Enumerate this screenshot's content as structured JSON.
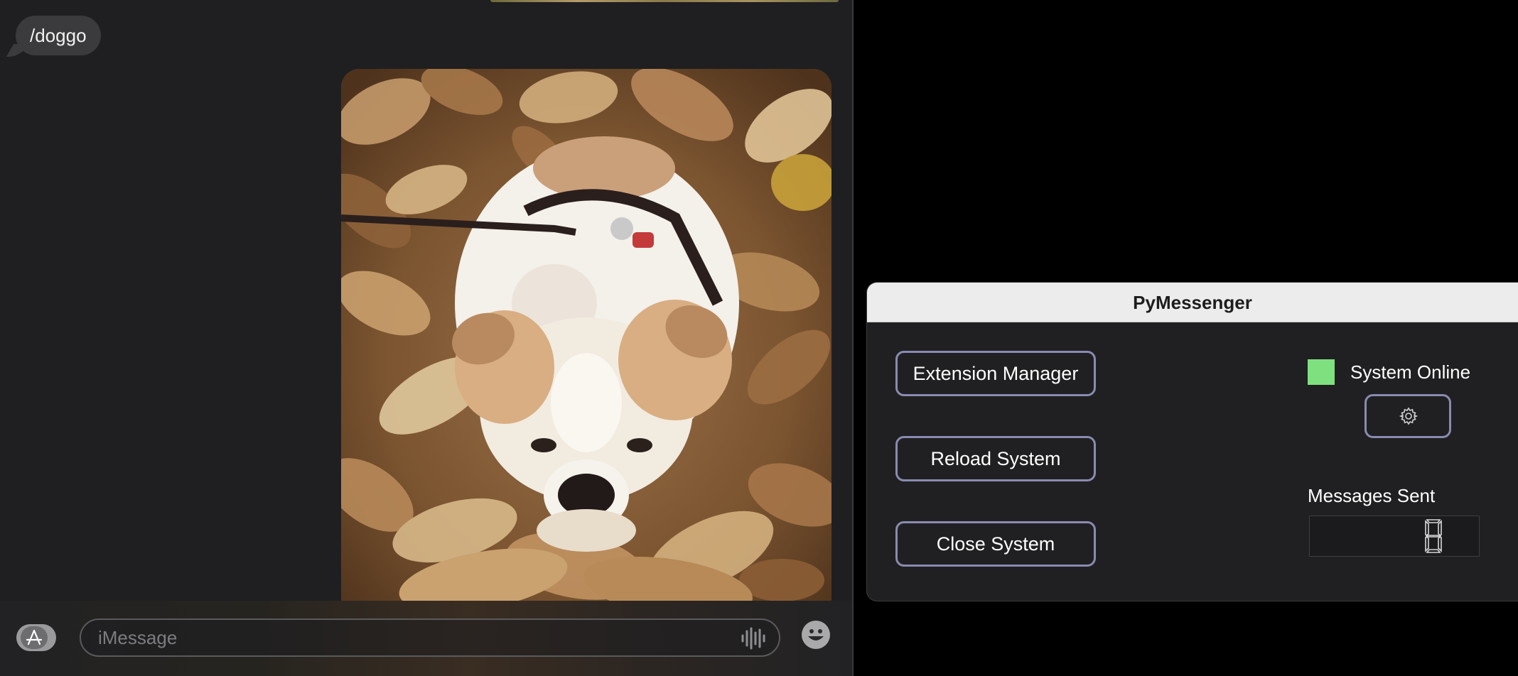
{
  "messages": {
    "bubble_text": "/doggo",
    "photo": {
      "subject": "bulldog-in-autumn-leaves"
    },
    "composer": {
      "placeholder": "iMessage",
      "apps_icon": "app-store-icon",
      "voice_icon": "waveform-icon",
      "emoji_icon": "emoji-icon"
    }
  },
  "pymessenger": {
    "title": "PyMessenger",
    "buttons": {
      "extension_manager": "Extension Manager",
      "reload_system": "Reload System",
      "close_system": "Close System"
    },
    "status": {
      "label": "System Online",
      "color": "#7ee07f"
    },
    "settings_icon": "gear-icon",
    "messages_sent": {
      "label": "Messages Sent",
      "value": 8
    },
    "accent_border": "#8a8ab2"
  }
}
